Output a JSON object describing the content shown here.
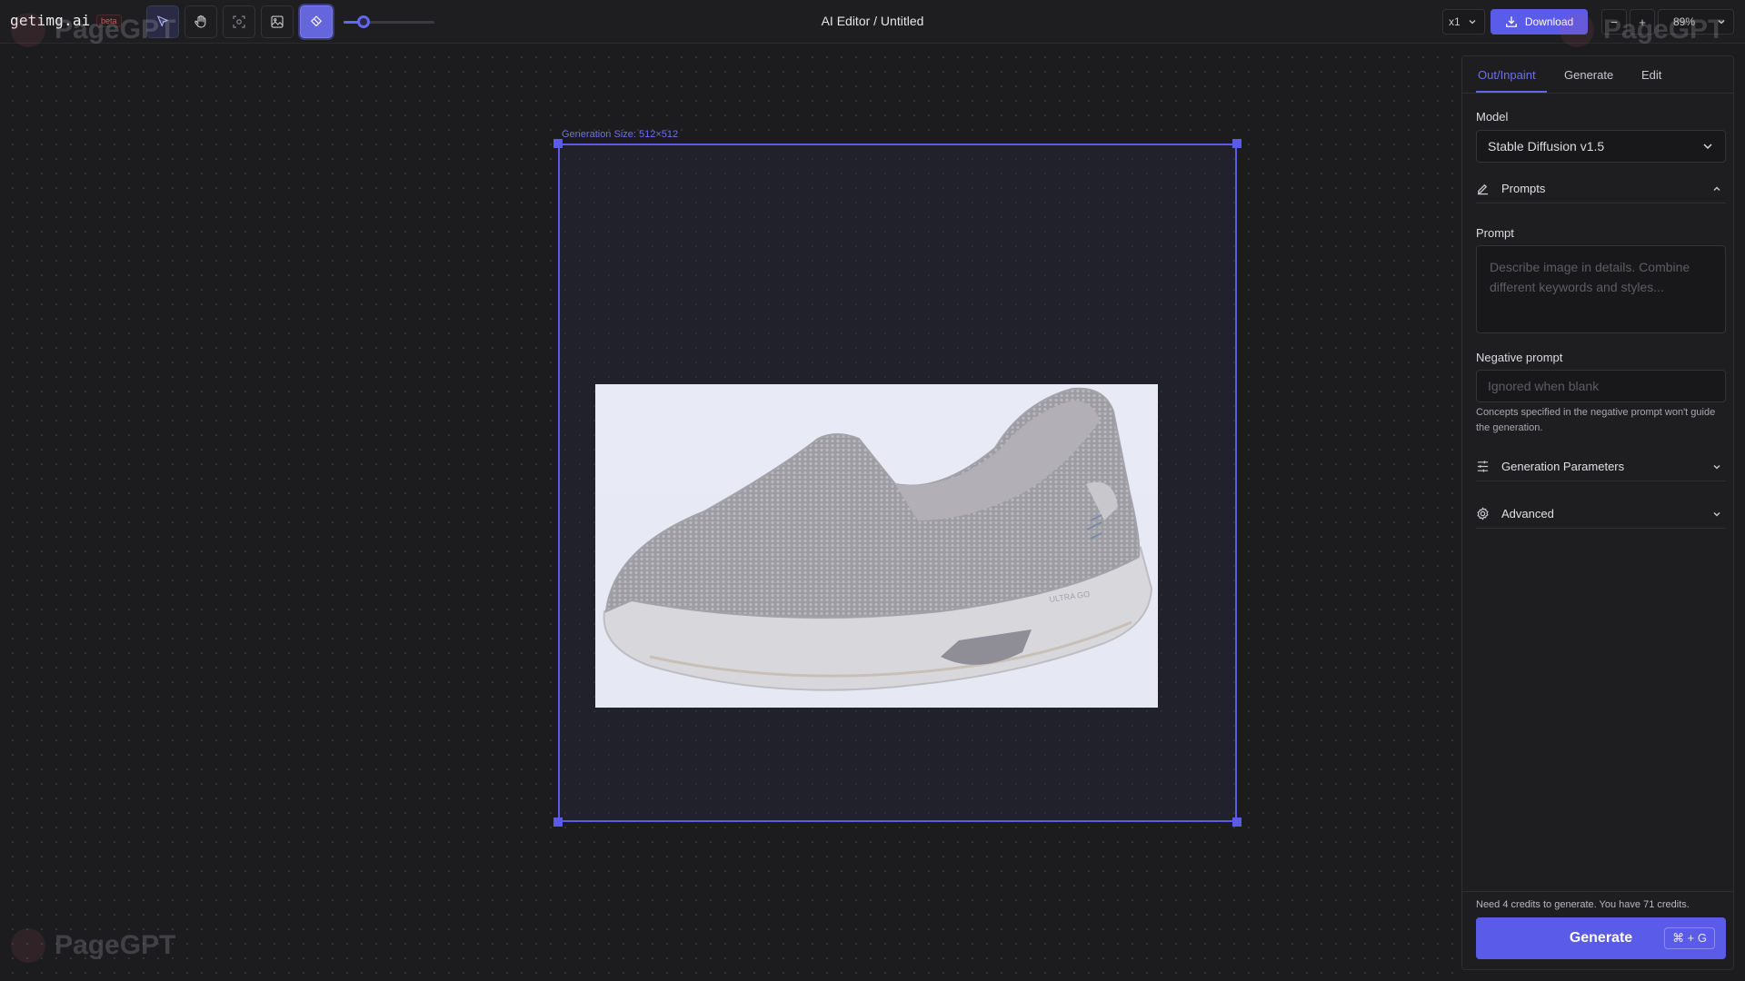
{
  "app": {
    "logo": "getimg.ai",
    "badge": "beta",
    "title": "AI Editor / Untitled"
  },
  "toolbar": {
    "tools": [
      {
        "name": "select",
        "icon": "cursor-arrow-icon",
        "selected": true
      },
      {
        "name": "pan",
        "icon": "hand-icon",
        "selected": false
      },
      {
        "name": "focus",
        "icon": "focus-icon",
        "selected": false
      },
      {
        "name": "image",
        "icon": "image-icon",
        "selected": false
      },
      {
        "name": "eraser",
        "icon": "eraser-icon",
        "selected": false,
        "active": true
      }
    ],
    "brush_size_fraction": 0.22
  },
  "header_right": {
    "scale": "x1",
    "download_label": "Download",
    "zoom_out": "−",
    "zoom_in": "+",
    "zoom_level": "89%"
  },
  "canvas": {
    "generation_size_label": "Generation Size: 512×512",
    "image_alt": "Grey mesh slip-on sneaker"
  },
  "panel": {
    "tabs": [
      {
        "label": "Out/Inpaint",
        "active": true
      },
      {
        "label": "Generate",
        "active": false
      },
      {
        "label": "Edit",
        "active": false
      }
    ],
    "model_label": "Model",
    "model_value": "Stable Diffusion v1.5",
    "prompts_section": "Prompts",
    "prompt_label": "Prompt",
    "prompt_value": "",
    "prompt_placeholder": "Describe image in details. Combine different keywords and styles...",
    "negative_label": "Negative prompt",
    "negative_value": "",
    "negative_placeholder": "Ignored when blank",
    "negative_hint": "Concepts specified in the negative prompt won't guide the generation.",
    "gen_params_section": "Generation Parameters",
    "advanced_section": "Advanced",
    "credits_text": "Need 4 credits to generate. You have 71 credits.",
    "generate_label": "Generate",
    "generate_shortcut": "⌘ + G"
  },
  "watermark": "PageGPT",
  "colors": {
    "accent": "#5b5bea",
    "background": "#1c1c1e",
    "panel": "#1e1e21"
  }
}
